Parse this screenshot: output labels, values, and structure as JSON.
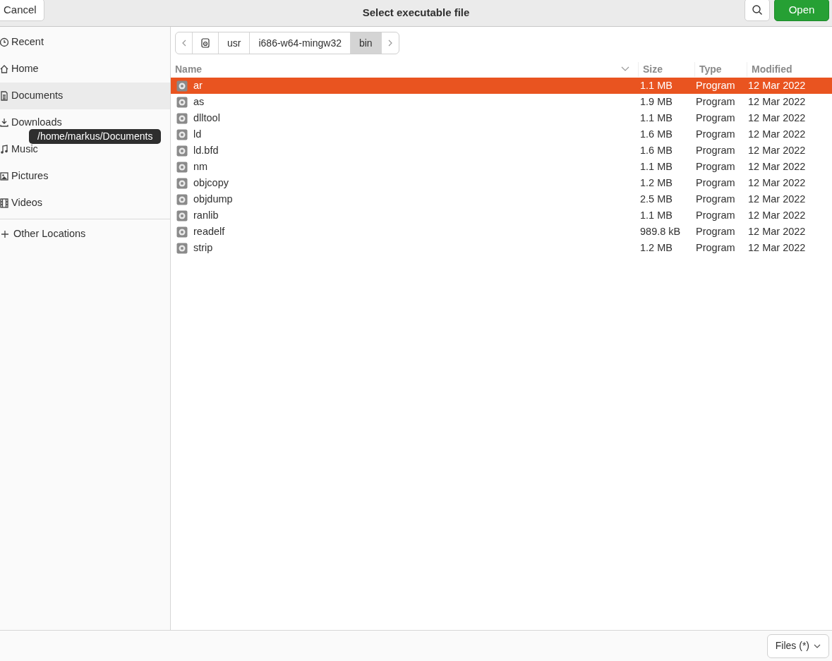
{
  "header": {
    "cancel": "Cancel",
    "title": "Select executable file",
    "open": "Open"
  },
  "sidebar": {
    "items": [
      {
        "label": "Recent",
        "selected": false
      },
      {
        "label": "Home",
        "selected": false
      },
      {
        "label": "Documents",
        "selected": true
      },
      {
        "label": "Downloads",
        "selected": false
      },
      {
        "label": "Music",
        "selected": false
      },
      {
        "label": "Pictures",
        "selected": false
      },
      {
        "label": "Videos",
        "selected": false
      }
    ],
    "other": {
      "label": "Other Locations"
    },
    "tooltip": "/home/markus/Documents"
  },
  "path_bar": {
    "segments": [
      {
        "kind": "drive",
        "selected": false
      },
      {
        "kind": "folder",
        "label": "usr",
        "selected": false
      },
      {
        "kind": "folder",
        "label": "i686-w64-mingw32",
        "selected": false
      },
      {
        "kind": "folder",
        "label": "bin",
        "selected": true
      }
    ]
  },
  "table": {
    "columns": [
      "Name",
      "Size",
      "Type",
      "Modified"
    ],
    "rows": [
      {
        "name": "ar",
        "size": "1.1 MB",
        "type": "Program",
        "modified": "12 Mar 2022",
        "selected": true
      },
      {
        "name": "as",
        "size": "1.9 MB",
        "type": "Program",
        "modified": "12 Mar 2022",
        "selected": false
      },
      {
        "name": "dlltool",
        "size": "1.1 MB",
        "type": "Program",
        "modified": "12 Mar 2022",
        "selected": false
      },
      {
        "name": "ld",
        "size": "1.6 MB",
        "type": "Program",
        "modified": "12 Mar 2022",
        "selected": false
      },
      {
        "name": "ld.bfd",
        "size": "1.6 MB",
        "type": "Program",
        "modified": "12 Mar 2022",
        "selected": false
      },
      {
        "name": "nm",
        "size": "1.1 MB",
        "type": "Program",
        "modified": "12 Mar 2022",
        "selected": false
      },
      {
        "name": "objcopy",
        "size": "1.2 MB",
        "type": "Program",
        "modified": "12 Mar 2022",
        "selected": false
      },
      {
        "name": "objdump",
        "size": "2.5 MB",
        "type": "Program",
        "modified": "12 Mar 2022",
        "selected": false
      },
      {
        "name": "ranlib",
        "size": "1.1 MB",
        "type": "Program",
        "modified": "12 Mar 2022",
        "selected": false
      },
      {
        "name": "readelf",
        "size": "989.8 kB",
        "type": "Program",
        "modified": "12 Mar 2022",
        "selected": false
      },
      {
        "name": "strip",
        "size": "1.2 MB",
        "type": "Program",
        "modified": "12 Mar 2022",
        "selected": false
      }
    ]
  },
  "footer": {
    "filter": "Files (*)"
  }
}
